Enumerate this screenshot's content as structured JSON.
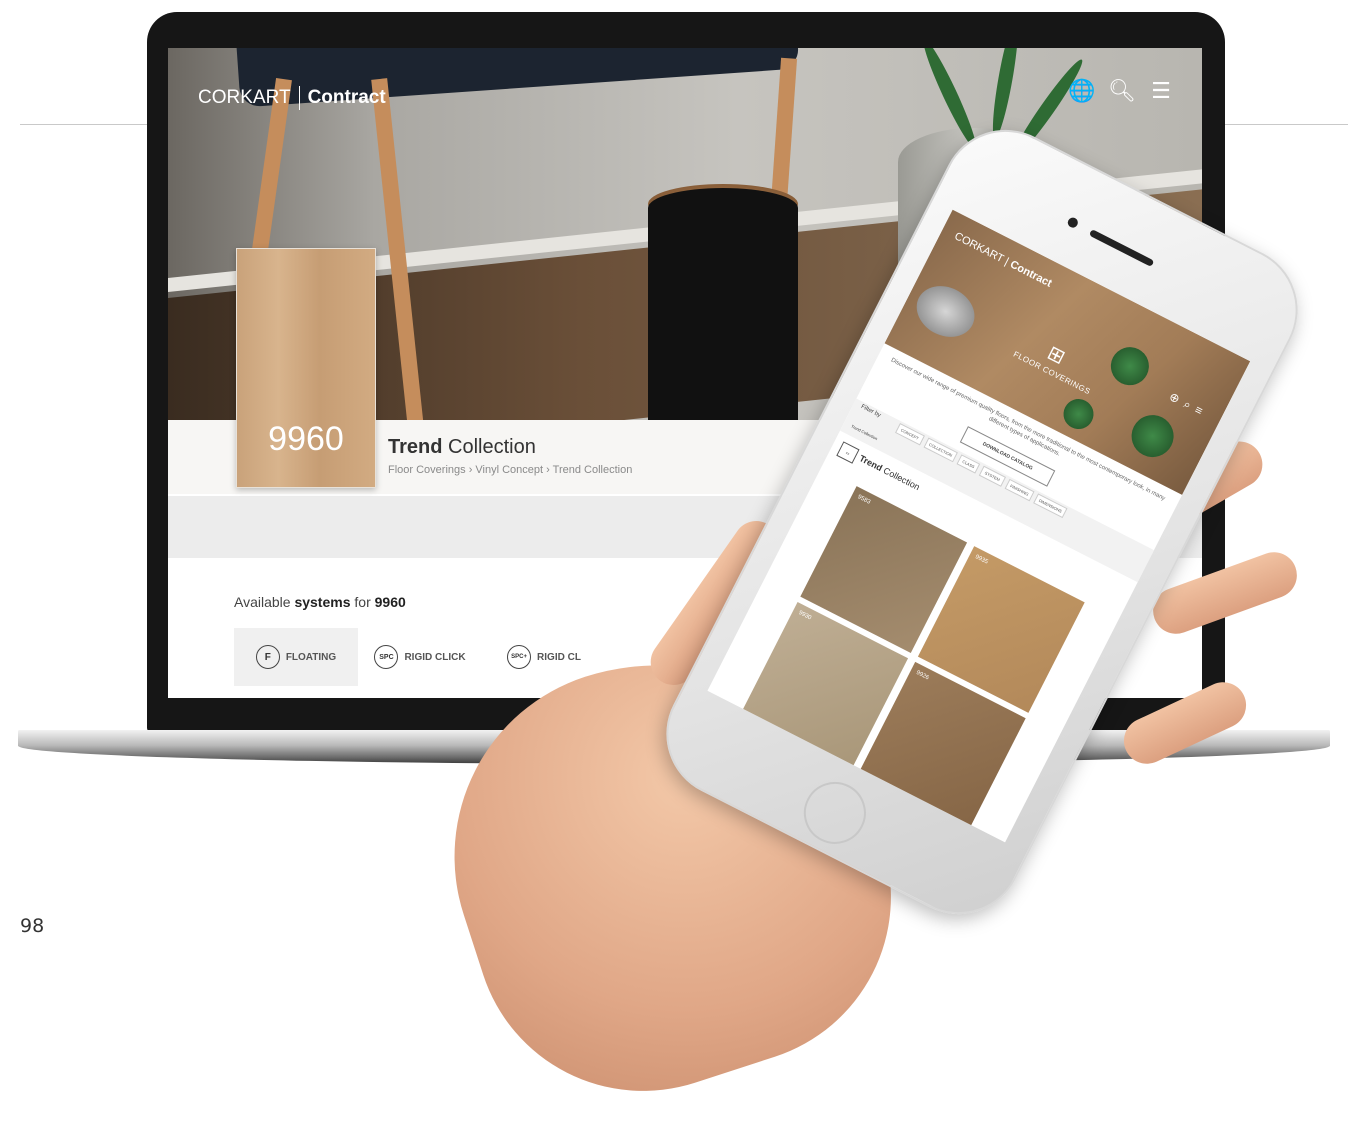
{
  "page_number": "98",
  "laptop": {
    "logo": {
      "brand": "CORKART",
      "product": "Contract"
    },
    "nav_icons": [
      "globe-icon",
      "search-icon",
      "menu-icon"
    ],
    "swatch_code": "9960",
    "collection": {
      "title_bold": "Trend",
      "title_rest": " Collection"
    },
    "breadcrumb": "Floor Coverings › Vinyl Concept › Trend Collection",
    "systems": {
      "prefix": "Available ",
      "bold": "systems",
      "mid": " for ",
      "code": "9960"
    },
    "tabs": [
      {
        "icon_text": "F",
        "label": "FLOATING",
        "active": true
      },
      {
        "icon_text": "SPC",
        "label": "RIGID CLICK",
        "active": false
      },
      {
        "icon_text": "SPC+",
        "label": "RIGID CL",
        "active": false
      }
    ]
  },
  "phone": {
    "logo": {
      "brand": "CORKART",
      "product": "Contract"
    },
    "floor_label": "FLOOR COVERINGS",
    "intro": "Discover our wide range of premium quality floors, from the more traditional to the most contemporary look, in many different types of applications.",
    "download_button": "DOWNLOAD CATALOG",
    "filter_label": "Filter by",
    "filter_chips": [
      "CONCEPT",
      "COLLECTION",
      "CLASS",
      "SYSTEM",
      "FINISHING",
      "DIMENSIONS"
    ],
    "active_tag": "Trend Collection",
    "collection": {
      "title_bold": "Trend",
      "title_rest": " Collection"
    },
    "tiles": [
      "9583",
      "9935",
      "9930",
      "9926"
    ]
  },
  "colors": {
    "wood": "#c9a27a",
    "text_dark": "#333333",
    "text_muted": "#8a8a8a",
    "band_light": "#f7f6f4",
    "band_gray": "#ececec"
  }
}
